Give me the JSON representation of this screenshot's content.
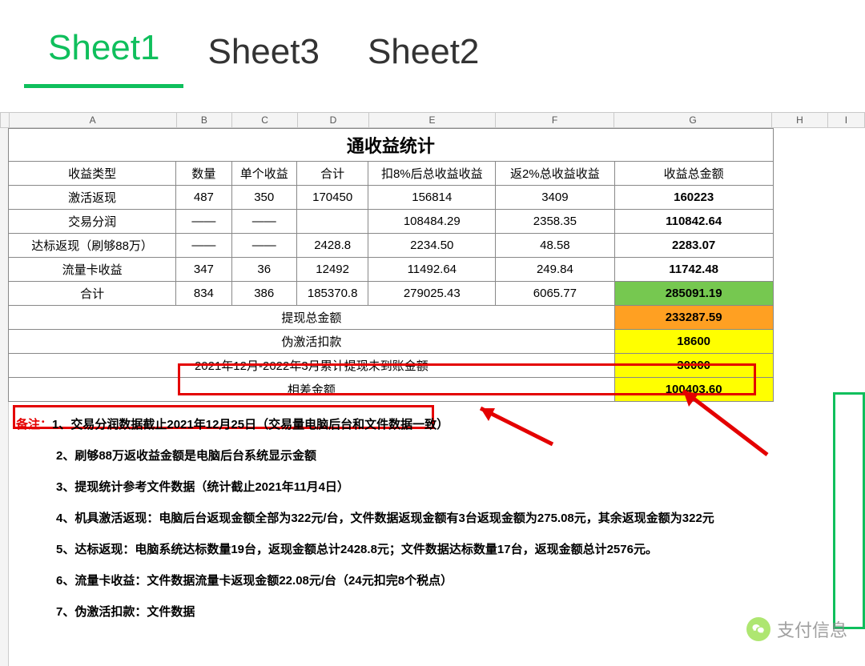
{
  "tabs": {
    "t1": "Sheet1",
    "t2": "Sheet3",
    "t3": "Sheet2"
  },
  "cols": {
    "a": "A",
    "b": "B",
    "c": "C",
    "d": "D",
    "e": "E",
    "f": "F",
    "g": "G",
    "h": "H",
    "i": "I"
  },
  "title": "通收益统计",
  "headers": {
    "type": "收益类型",
    "qty": "数量",
    "unit": "单个收益",
    "sum": "合计",
    "after8": "扣8%后总收益收益",
    "ret2": "返2%总收益收益",
    "total": "收益总金额"
  },
  "rows": {
    "r1": {
      "type": "激活返现",
      "qty": "487",
      "unit": "350",
      "sum": "170450",
      "after8": "156814",
      "ret2": "3409",
      "total": "160223"
    },
    "r2": {
      "type": "交易分润",
      "qty": "——",
      "unit": "——",
      "sum": "",
      "after8": "108484.29",
      "ret2": "2358.35",
      "total": "110842.64"
    },
    "r3": {
      "type": "达标返现（刷够88万）",
      "qty": "——",
      "unit": "——",
      "sum": "2428.8",
      "after8": "2234.50",
      "ret2": "48.58",
      "total": "2283.07"
    },
    "r4": {
      "type": "流量卡收益",
      "qty": "347",
      "unit": "36",
      "sum": "12492",
      "after8": "11492.64",
      "ret2": "249.84",
      "total": "11742.48"
    },
    "r5": {
      "type": "合计",
      "qty": "834",
      "unit": "386",
      "sum": "185370.8",
      "after8": "279025.43",
      "ret2": "6065.77",
      "total": "285091.19"
    }
  },
  "summary": {
    "s1": {
      "label": "提现总金额",
      "val": "233287.59"
    },
    "s2": {
      "label": "伪激活扣款",
      "val": "18600"
    },
    "s3": {
      "label": "2021年12月-2022年3月累计提现未到账金额",
      "val": "30000"
    },
    "s4": {
      "label": "相差金额",
      "val": "100403.60"
    }
  },
  "notes": {
    "prefix": "备注：",
    "n1": "1、交易分润数据截止2021年12月25日（交易量电脑后台和文件数据一致）",
    "n2": "2、刷够88万返收益金额是电脑后台系统显示金额",
    "n3": "3、提现统计参考文件数据（统计截止2021年11月4日）",
    "n4": "4、机具激活返现：电脑后台返现金额全部为322元/台，文件数据返现金额有3台返现金额为275.08元，其余返现金额为322元",
    "n5": "5、达标返现：电脑系统达标数量19台，返现金额总计2428.8元；文件数据达标数量17台，返现金额总计2576元。",
    "n6": "6、流量卡收益：文件数据流量卡返现金额22.08元/台（24元扣完8个税点）",
    "n7": "7、伪激活扣款：文件数据"
  },
  "watermark": "支付信息"
}
